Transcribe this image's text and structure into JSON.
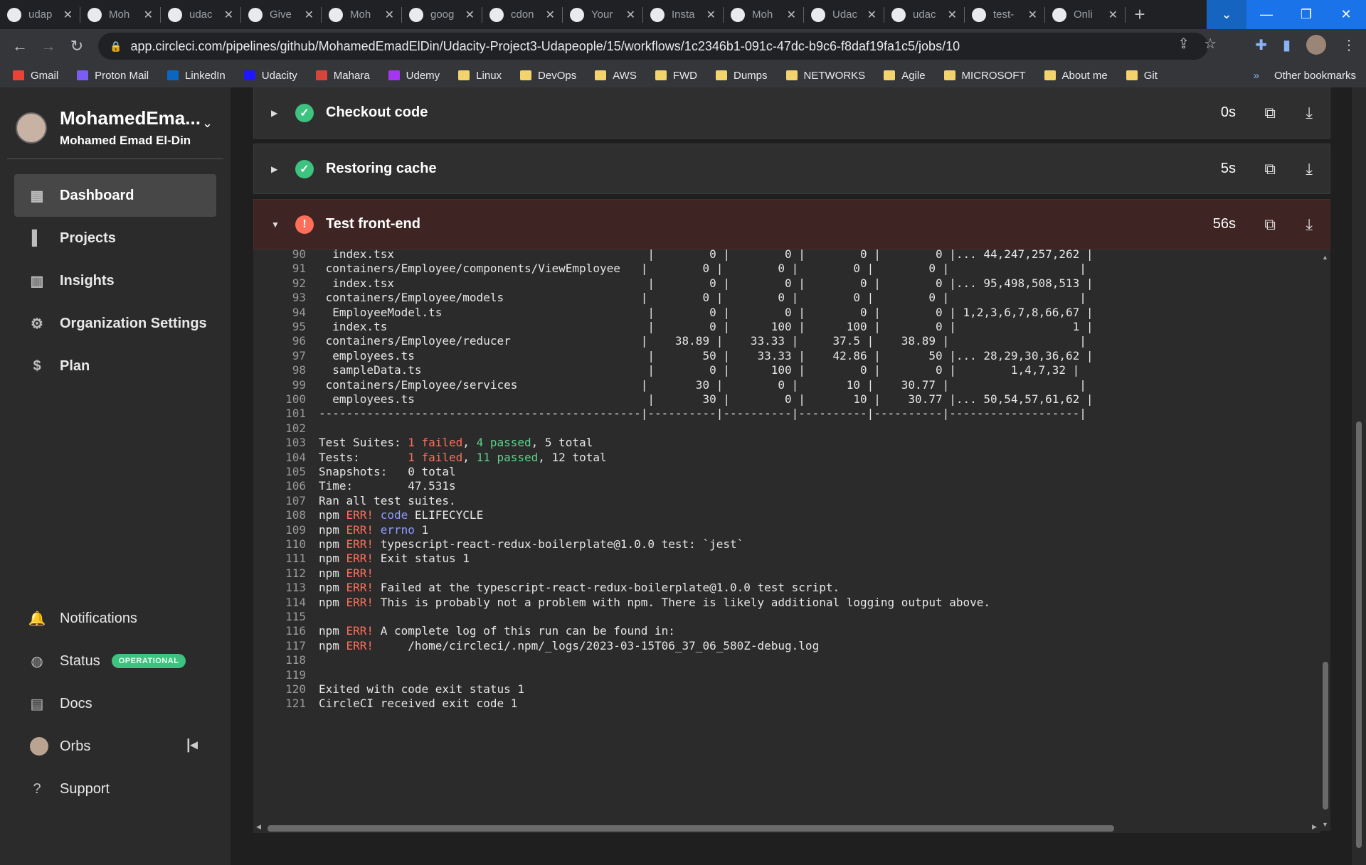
{
  "tabs": [
    {
      "label": "udap",
      "icon": "github-icon"
    },
    {
      "label": "Moh",
      "icon": "github-icon"
    },
    {
      "label": "udac",
      "icon": "github-icon"
    },
    {
      "label": "Give",
      "icon": "udacity-icon"
    },
    {
      "label": "Moh",
      "icon": "github-icon"
    },
    {
      "label": "goog",
      "icon": "google-icon"
    },
    {
      "label": "cdon",
      "icon": "github-icon"
    },
    {
      "label": "Your",
      "icon": "github-icon"
    },
    {
      "label": "Insta",
      "icon": "instance-icon"
    },
    {
      "label": "Moh",
      "icon": "github-icon"
    },
    {
      "label": "Udac",
      "icon": "udacity-icon"
    },
    {
      "label": "udac",
      "icon": "github-icon"
    },
    {
      "label": "test-",
      "icon": "circleci-icon"
    },
    {
      "label": "Onli",
      "icon": "online-icon"
    }
  ],
  "address": {
    "url": "app.circleci.com/pipelines/github/MohamedEmadElDin/Udacity-Project3-Udapeople/15/workflows/1c2346b1-091c-47dc-b9c6-f8daf19fa1c5/jobs/10"
  },
  "bookmarks": [
    "Gmail",
    "Proton Mail",
    "LinkedIn",
    "Udacity",
    "Mahara",
    "Udemy",
    "Linux",
    "DevOps",
    "AWS",
    "FWD",
    "Dumps",
    "NETWORKS",
    "Agile",
    "MICROSOFT",
    "About me",
    "Git"
  ],
  "bookmarks_more": "»",
  "bookmarks_other": "Other bookmarks",
  "org": {
    "name": "MohamedEma...",
    "user": "Mohamed Emad El-Din"
  },
  "nav": {
    "dashboard": "Dashboard",
    "projects": "Projects",
    "insights": "Insights",
    "org_settings": "Organization Settings",
    "plan": "Plan",
    "notifications": "Notifications",
    "status": "Status",
    "status_badge": "OPERATIONAL",
    "docs": "Docs",
    "orbs": "Orbs",
    "support": "Support"
  },
  "steps": [
    {
      "name": "Checkout code",
      "duration": "0s",
      "status": "success"
    },
    {
      "name": "Restoring cache",
      "duration": "5s",
      "status": "success"
    },
    {
      "name": "Test front-end",
      "duration": "56s",
      "status": "failed"
    }
  ],
  "console": [
    {
      "n": "90",
      "segs": [
        [
          "  index.tsx                                     |        0 |        0 |        0 |        0 |... 44,247,257,262 |",
          "cov"
        ]
      ]
    },
    {
      "n": "91",
      "segs": [
        [
          " containers/Employee/components/ViewEmployee   |        0 |        0 |        0 |        0 |                   |",
          "cov"
        ]
      ]
    },
    {
      "n": "92",
      "segs": [
        [
          "  index.tsx                                     |        0 |        0 |        0 |        0 |... 95,498,508,513 |",
          "cov"
        ]
      ]
    },
    {
      "n": "93",
      "segs": [
        [
          " containers/Employee/models                    |        0 |        0 |        0 |        0 |                   |",
          "cov"
        ]
      ]
    },
    {
      "n": "94",
      "segs": [
        [
          "  EmployeeModel.ts                              |        0 |        0 |        0 |        0 | 1,2,3,6,7,8,66,67 |",
          "cov"
        ]
      ]
    },
    {
      "n": "95",
      "segs": [
        [
          "  index.ts                                      |        0 |      100 |      100 |        0 |                 1 |",
          "cov"
        ]
      ]
    },
    {
      "n": "96",
      "segs": [
        [
          " containers/Employee/reducer                   |    38.89 |    33.33 |     37.5 |    38.89 |                   |",
          "cov"
        ]
      ]
    },
    {
      "n": "97",
      "segs": [
        [
          "  employees.ts                                  |       50 |    33.33 |    42.86 |       50 |... 28,29,30,36,62 |",
          "cov"
        ]
      ]
    },
    {
      "n": "98",
      "segs": [
        [
          "  sampleData.ts                                 |        0 |      100 |        0 |        0 |        1,4,7,32 |",
          "cov"
        ]
      ]
    },
    {
      "n": "99",
      "segs": [
        [
          " containers/Employee/services                  |       30 |        0 |       10 |    30.77 |                   |",
          "cov"
        ]
      ]
    },
    {
      "n": "100",
      "segs": [
        [
          "  employees.ts                                  |       30 |        0 |       10 |    30.77 |... 50,54,57,61,62 |",
          "cov"
        ]
      ]
    },
    {
      "n": "101",
      "segs": [
        [
          "-----------------------------------------------|----------|----------|----------|----------|-------------------|",
          "plain"
        ]
      ]
    },
    {
      "n": "102",
      "segs": [
        [
          "",
          "plain"
        ]
      ]
    },
    {
      "n": "103",
      "segs": [
        [
          "Test Suites: ",
          "plain"
        ],
        [
          "1 failed",
          "red"
        ],
        [
          ", ",
          "plain"
        ],
        [
          "4 passed",
          "green"
        ],
        [
          ", 5 total",
          "plain"
        ]
      ]
    },
    {
      "n": "104",
      "segs": [
        [
          "Tests:       ",
          "plain"
        ],
        [
          "1 failed",
          "red"
        ],
        [
          ", ",
          "plain"
        ],
        [
          "11 passed",
          "green"
        ],
        [
          ", 12 total",
          "plain"
        ]
      ]
    },
    {
      "n": "105",
      "segs": [
        [
          "Snapshots:   0 total",
          "plain"
        ]
      ]
    },
    {
      "n": "106",
      "segs": [
        [
          "Time:        47.531s",
          "plain"
        ]
      ]
    },
    {
      "n": "107",
      "segs": [
        [
          "Ran all test suites.",
          "plain"
        ]
      ]
    },
    {
      "n": "108",
      "segs": [
        [
          "npm ",
          "plain"
        ],
        [
          "ERR!",
          "red"
        ],
        [
          " ",
          "plain"
        ],
        [
          "code",
          "blue"
        ],
        [
          " ELIFECYCLE",
          "plain"
        ]
      ]
    },
    {
      "n": "109",
      "segs": [
        [
          "npm ",
          "plain"
        ],
        [
          "ERR!",
          "red"
        ],
        [
          " ",
          "plain"
        ],
        [
          "errno",
          "blue"
        ],
        [
          " 1",
          "plain"
        ]
      ]
    },
    {
      "n": "110",
      "segs": [
        [
          "npm ",
          "plain"
        ],
        [
          "ERR!",
          "red"
        ],
        [
          " typescript-react-redux-boilerplate@1.0.0 test: `jest`",
          "plain"
        ]
      ]
    },
    {
      "n": "111",
      "segs": [
        [
          "npm ",
          "plain"
        ],
        [
          "ERR!",
          "red"
        ],
        [
          " Exit status 1",
          "plain"
        ]
      ]
    },
    {
      "n": "112",
      "segs": [
        [
          "npm ",
          "plain"
        ],
        [
          "ERR!",
          "red"
        ]
      ]
    },
    {
      "n": "113",
      "segs": [
        [
          "npm ",
          "plain"
        ],
        [
          "ERR!",
          "red"
        ],
        [
          " Failed at the typescript-react-redux-boilerplate@1.0.0 test script.",
          "plain"
        ]
      ]
    },
    {
      "n": "114",
      "segs": [
        [
          "npm ",
          "plain"
        ],
        [
          "ERR!",
          "red"
        ],
        [
          " This is probably not a problem with npm. There is likely additional logging output above.",
          "plain"
        ]
      ]
    },
    {
      "n": "115",
      "segs": [
        [
          "",
          "plain"
        ]
      ]
    },
    {
      "n": "116",
      "segs": [
        [
          "npm ",
          "plain"
        ],
        [
          "ERR!",
          "red"
        ],
        [
          " A complete log of this run can be found in:",
          "plain"
        ]
      ]
    },
    {
      "n": "117",
      "segs": [
        [
          "npm ",
          "plain"
        ],
        [
          "ERR!",
          "red"
        ],
        [
          "     /home/circleci/.npm/_logs/2023-03-15T06_37_06_580Z-debug.log",
          "plain"
        ]
      ]
    },
    {
      "n": "118",
      "segs": [
        [
          "",
          "plain"
        ]
      ]
    },
    {
      "n": "119",
      "segs": [
        [
          "",
          "plain"
        ]
      ]
    },
    {
      "n": "120",
      "segs": [
        [
          "Exited with code exit status 1",
          "plain"
        ]
      ]
    },
    {
      "n": "121",
      "segs": [
        [
          "CircleCI received exit code 1",
          "plain"
        ]
      ]
    }
  ]
}
